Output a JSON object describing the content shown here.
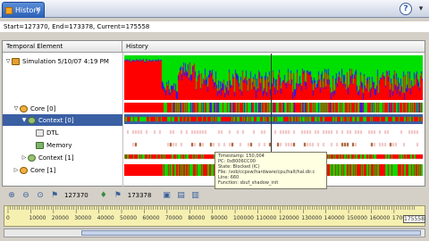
{
  "window": {
    "tab_title": "History",
    "close_glyph": "✕",
    "help_glyph": "?"
  },
  "range": {
    "text": "Start=127370, End=173378, Current=175558"
  },
  "columns": {
    "left": "Temporal Element",
    "right": "History"
  },
  "tree": [
    {
      "twisty": "▽",
      "icon": "simulation-icon",
      "label": "Simulation 5/10/07 4:19 PM",
      "indent": 0,
      "selected": false
    },
    {
      "twisty": "▽",
      "icon": "core-icon",
      "label": "Core [0]",
      "indent": 1,
      "selected": false
    },
    {
      "twisty": "▼",
      "icon": "context-icon",
      "label": "Context [0]",
      "indent": 2,
      "selected": true
    },
    {
      "twisty": "",
      "icon": "dtl-icon",
      "label": "DTL",
      "indent": 3,
      "selected": false
    },
    {
      "twisty": "",
      "icon": "memory-icon",
      "label": "Memory",
      "indent": 3,
      "selected": false
    },
    {
      "twisty": "▷",
      "icon": "context-icon",
      "label": "Context [1]",
      "indent": 2,
      "selected": false
    },
    {
      "twisty": "▷",
      "icon": "core-icon",
      "label": "Core [1]",
      "indent": 1,
      "selected": false
    }
  ],
  "tooltip": {
    "lines": [
      "Timestamp: 150,004",
      "PC: 0x8006CC00",
      "State: Blocked (IC)",
      "File: /vob/ccpsw/hardware/cpu/halt/hal.dir.c",
      "Line: 660",
      "Function: sbuf_shadow_init"
    ]
  },
  "toolbar": {
    "start_value": "127370",
    "end_value": "173378"
  },
  "ruler": {
    "ticks": [
      "0",
      "10000",
      "20000",
      "30000",
      "40000",
      "50000",
      "60000",
      "70000",
      "80000",
      "90000",
      "100000",
      "110000",
      "120000",
      "130000",
      "140000",
      "150000",
      "160000",
      "170000"
    ],
    "end_label": "175558"
  },
  "colors": {
    "busy": "#00e000",
    "idle": "#ff0000",
    "blocked": "#1a1aff",
    "selection": "#3a5fa3"
  }
}
